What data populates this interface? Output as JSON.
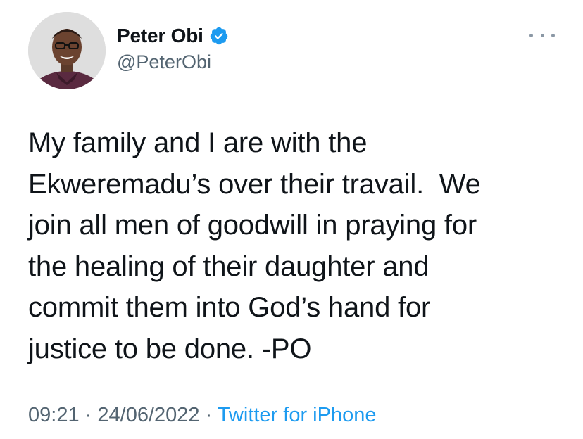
{
  "author": {
    "display_name": "Peter Obi",
    "handle": "@PeterObi",
    "verified": true,
    "avatar": "avatar-photo"
  },
  "menu_icon": "more-horizontal-icon",
  "tweet": {
    "lines": [
      "My family and I are with the",
      "Ekweremadu’s over their travail.  We",
      "join all men of goodwill in praying for",
      "the healing of their daughter and",
      "commit them into God’s hand for",
      "justice to be done. -PO"
    ]
  },
  "meta": {
    "time": "09:21",
    "separator": "·",
    "date": "24/06/2022",
    "source": "Twitter for iPhone"
  },
  "colors": {
    "text": "#0f1419",
    "secondary": "#536471",
    "accent": "#1d9bf0"
  }
}
